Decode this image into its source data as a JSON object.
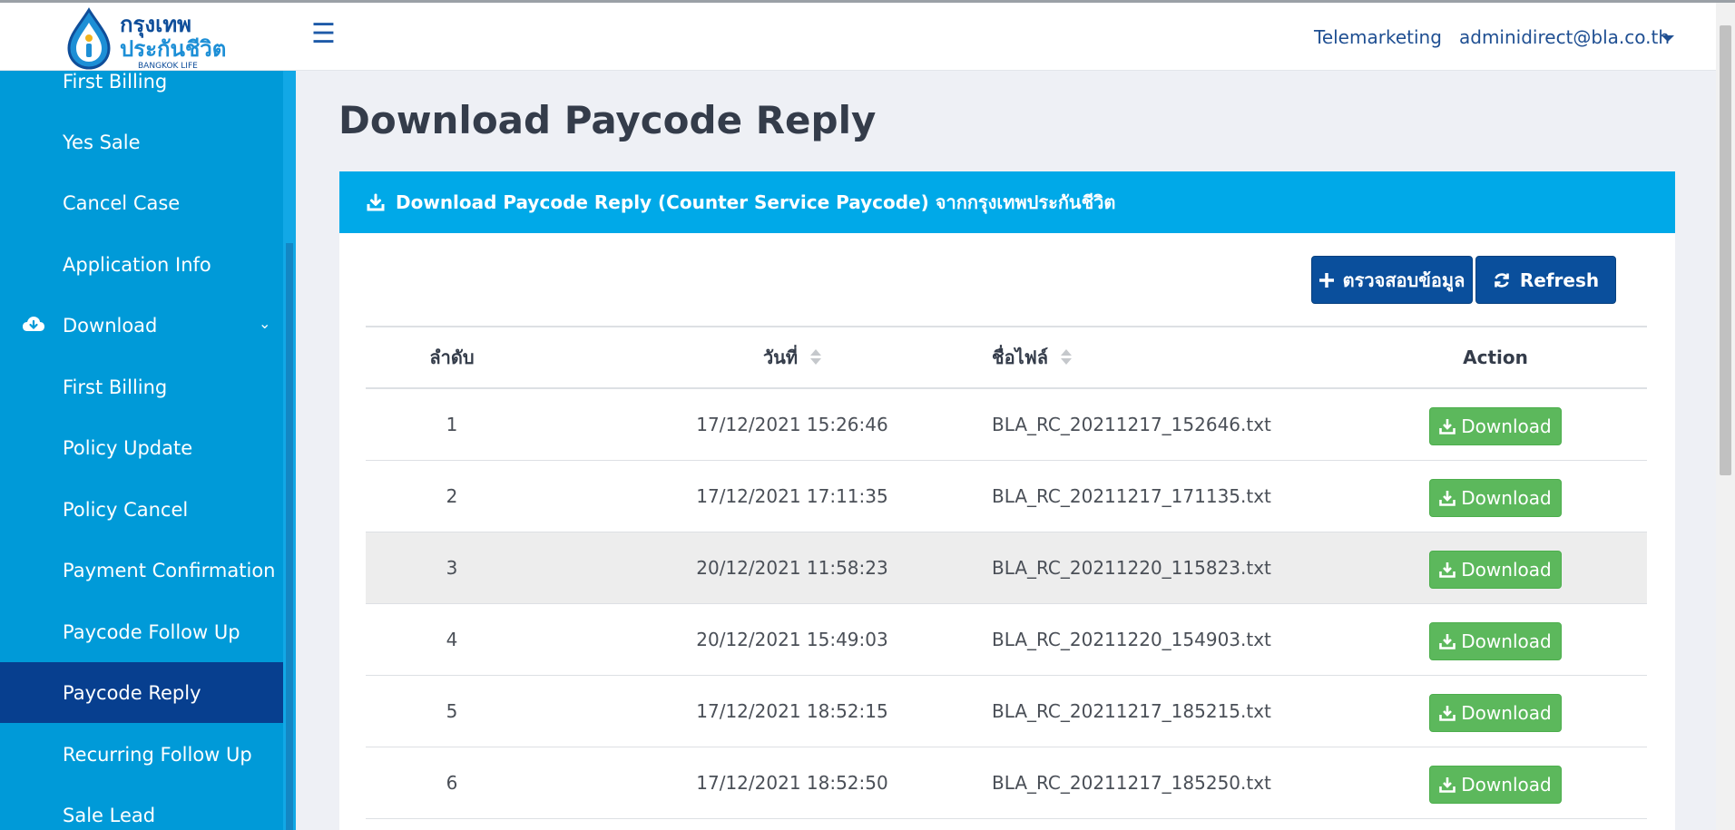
{
  "brand": {
    "logo_thai_line1": "กรุงเทพ",
    "logo_thai_line2": "ประกันชีวิต",
    "logo_en": "BANGKOK LIFE"
  },
  "header": {
    "role_link": "Telemarketing",
    "user_email": "adminidirect@bla.co.th"
  },
  "sidebar": {
    "items": [
      {
        "label": "First Billing"
      },
      {
        "label": "Yes Sale"
      },
      {
        "label": "Cancel Case"
      },
      {
        "label": "Application Info"
      },
      {
        "label": "Download",
        "icon": "cloud-download-icon",
        "expandable": true
      },
      {
        "label": "First Billing"
      },
      {
        "label": "Policy Update"
      },
      {
        "label": "Policy Cancel"
      },
      {
        "label": "Payment Confirmation"
      },
      {
        "label": "Paycode Follow Up"
      },
      {
        "label": "Paycode Reply",
        "active": true
      },
      {
        "label": "Recurring Follow Up"
      },
      {
        "label": "Sale Lead"
      }
    ]
  },
  "page": {
    "title": "Download Paycode Reply"
  },
  "panel": {
    "heading": "Download Paycode Reply (Counter Service Paycode) จากกรุงเทพประกันชีวิต",
    "verify_button": "ตรวจสอบข้อมูล",
    "refresh_button": "Refresh"
  },
  "table": {
    "columns": [
      "ลำดับ",
      "วันที่",
      "ชื่อไฟล์",
      "Action"
    ],
    "action_label": "Download",
    "rows": [
      {
        "no": "1",
        "date": "17/12/2021 15:26:46",
        "file": "BLA_RC_20211217_152646.txt"
      },
      {
        "no": "2",
        "date": "17/12/2021 17:11:35",
        "file": "BLA_RC_20211217_171135.txt"
      },
      {
        "no": "3",
        "date": "20/12/2021 11:58:23",
        "file": "BLA_RC_20211220_115823.txt"
      },
      {
        "no": "4",
        "date": "20/12/2021 15:49:03",
        "file": "BLA_RC_20211220_154903.txt"
      },
      {
        "no": "5",
        "date": "17/12/2021 18:52:15",
        "file": "BLA_RC_20211217_185215.txt"
      },
      {
        "no": "6",
        "date": "17/12/2021 18:52:50",
        "file": "BLA_RC_20211217_185250.txt"
      }
    ]
  },
  "colors": {
    "sidebar_bg": "#009ad8",
    "sidebar_active": "#073f8f",
    "panel_header": "#00a9e8",
    "primary_button": "#0a4f9c",
    "download_button": "#5cb85c"
  }
}
